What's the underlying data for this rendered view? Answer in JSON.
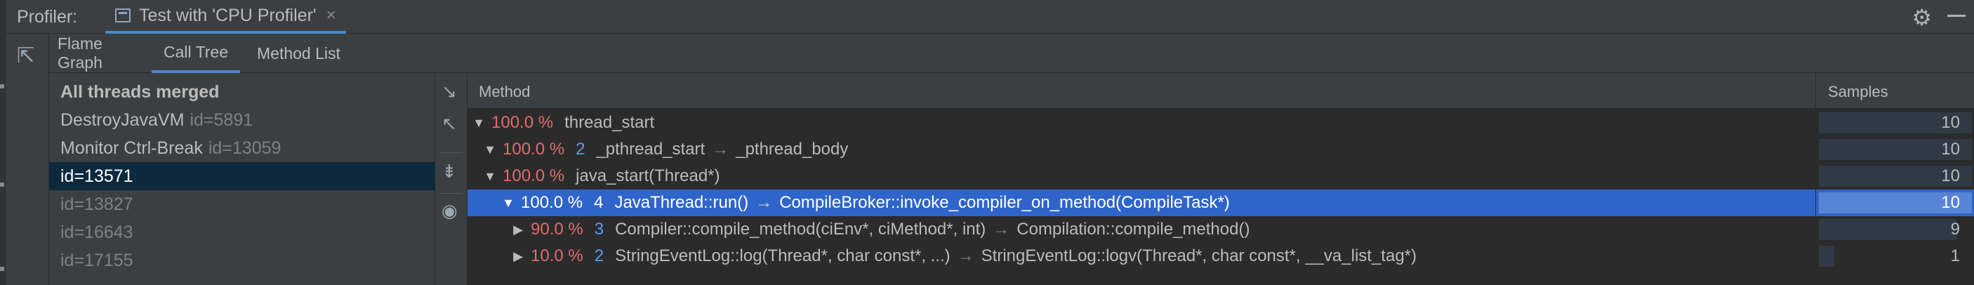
{
  "header": {
    "title": "Profiler:",
    "tab_label": "Test with 'CPU Profiler'",
    "tab_close": "×"
  },
  "icons": {
    "tab": "window-icon",
    "close": "close-icon",
    "settings": "gear-icon",
    "minimize": "minimize-icon",
    "export": "export-icon",
    "expand": "expand-all-icon",
    "collapse": "collapse-all-icon",
    "merge": "merge-icon",
    "view": "eye-icon"
  },
  "subtabs": [
    {
      "label": "Flame Graph",
      "active": false
    },
    {
      "label": "Call Tree",
      "active": true
    },
    {
      "label": "Method List",
      "active": false
    }
  ],
  "threads": [
    {
      "name": "All threads merged",
      "id": "",
      "kind": "header"
    },
    {
      "name": "DestroyJavaVM",
      "id": "id=5891",
      "kind": "normal"
    },
    {
      "name": "Monitor Ctrl-Break",
      "id": "id=13059",
      "kind": "normal"
    },
    {
      "name": "id=13571",
      "id": "",
      "kind": "selected"
    },
    {
      "name": "id=13827",
      "id": "",
      "kind": "dim"
    },
    {
      "name": "id=16643",
      "id": "",
      "kind": "dim"
    },
    {
      "name": "id=17155",
      "id": "",
      "kind": "dim"
    }
  ],
  "table": {
    "method_header": "Method",
    "samples_header": "Samples",
    "chain_arrow": "→",
    "rows": [
      {
        "arrow": "▼",
        "pct": "100.0 %",
        "count": "",
        "method": "thread_start",
        "callee": "",
        "samples": "10",
        "fraction": 1.0,
        "selected": false
      },
      {
        "arrow": "▼",
        "pct": "100.0 %",
        "count": "2",
        "method": "_pthread_start",
        "callee": "_pthread_body",
        "samples": "10",
        "fraction": 1.0,
        "selected": false
      },
      {
        "arrow": "▼",
        "pct": "100.0 %",
        "count": "",
        "method": "java_start(Thread*)",
        "callee": "",
        "samples": "10",
        "fraction": 1.0,
        "selected": false
      },
      {
        "arrow": "▼",
        "pct": "100.0 %",
        "count": "4",
        "method": "JavaThread::run()",
        "callee": "CompileBroker::invoke_compiler_on_method(CompileTask*)",
        "samples": "10",
        "fraction": 1.0,
        "selected": true
      },
      {
        "arrow": "▶",
        "pct": "90.0 %",
        "count": "3",
        "method": "Compiler::compile_method(ciEnv*, ciMethod*, int)",
        "callee": "Compilation::compile_method()",
        "samples": "9",
        "fraction": 0.9,
        "selected": false
      },
      {
        "arrow": "▶",
        "pct": "10.0 %",
        "count": "2",
        "method": "StringEventLog::log(Thread*, char const*, ...)",
        "callee": "StringEventLog::logv(Thread*, char const*, __va_list_tag*)",
        "samples": "1",
        "fraction": 0.1,
        "selected": false
      }
    ]
  },
  "colors": {
    "background": "#3c3f41",
    "table_background": "#2b2b2b",
    "selection": "#2f65ca",
    "thread_selection": "#0d293e",
    "percent": "#e06c6c",
    "count": "#589df6",
    "accent": "#4a88c7"
  }
}
